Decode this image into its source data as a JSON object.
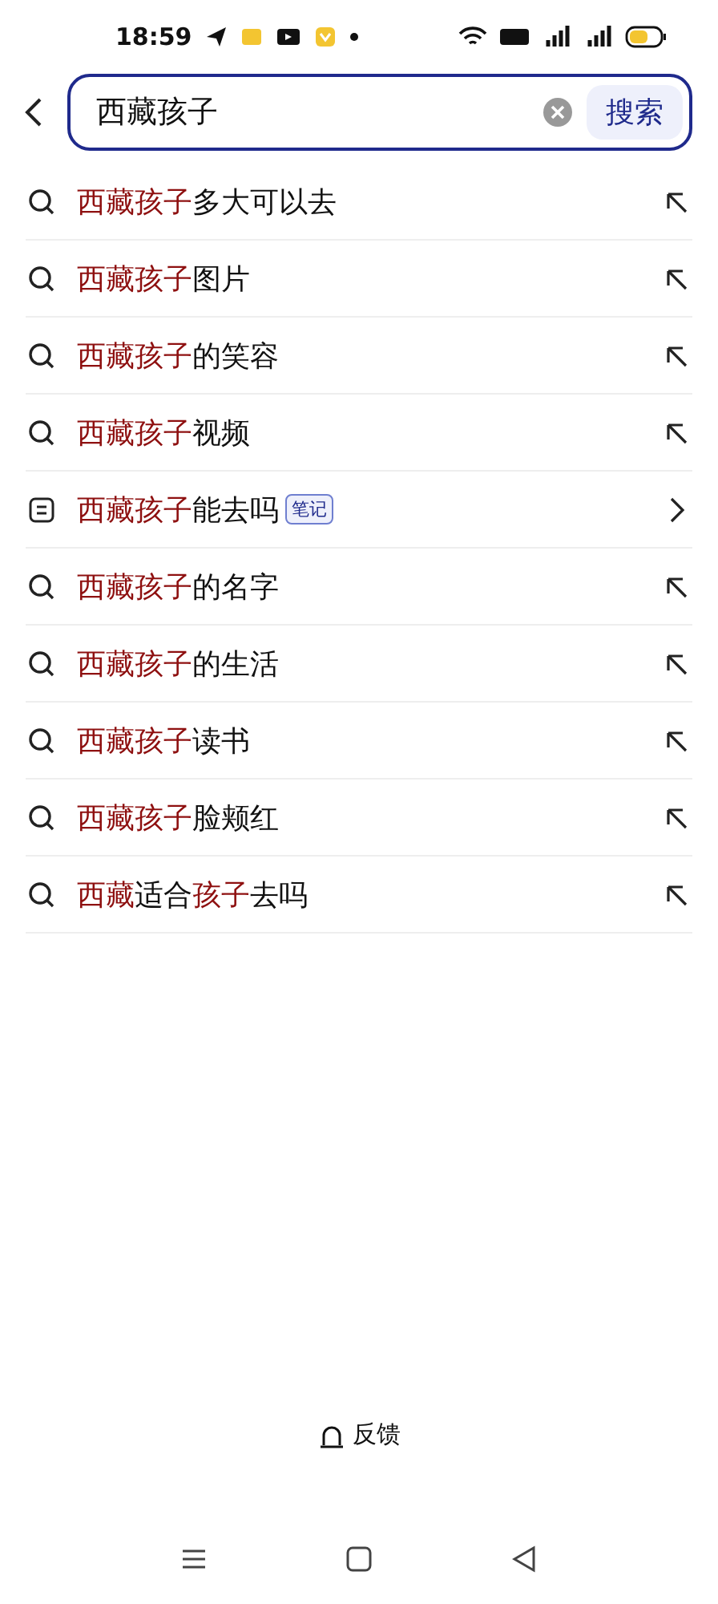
{
  "status_bar": {
    "time": "18:59"
  },
  "search": {
    "value": "西藏孩子",
    "button": "搜索"
  },
  "suggestions": [
    {
      "kind": "search",
      "parts": [
        {
          "text": "西藏孩子",
          "highlight": true
        },
        {
          "text": "多大可以去",
          "highlight": false
        }
      ]
    },
    {
      "kind": "search",
      "parts": [
        {
          "text": "西藏孩子",
          "highlight": true
        },
        {
          "text": "图片",
          "highlight": false
        }
      ]
    },
    {
      "kind": "search",
      "parts": [
        {
          "text": "西藏孩子",
          "highlight": true
        },
        {
          "text": "的笑容",
          "highlight": false
        }
      ]
    },
    {
      "kind": "search",
      "parts": [
        {
          "text": "西藏孩子",
          "highlight": true
        },
        {
          "text": "视频",
          "highlight": false
        }
      ]
    },
    {
      "kind": "note",
      "parts": [
        {
          "text": "西藏孩子",
          "highlight": true
        },
        {
          "text": "能去吗",
          "highlight": false
        }
      ],
      "badge": "笔记"
    },
    {
      "kind": "search",
      "parts": [
        {
          "text": "西藏孩子",
          "highlight": true
        },
        {
          "text": "的名字",
          "highlight": false
        }
      ]
    },
    {
      "kind": "search",
      "parts": [
        {
          "text": "西藏孩子",
          "highlight": true
        },
        {
          "text": "的生活",
          "highlight": false
        }
      ]
    },
    {
      "kind": "search",
      "parts": [
        {
          "text": "西藏孩子",
          "highlight": true
        },
        {
          "text": "读书",
          "highlight": false
        }
      ]
    },
    {
      "kind": "search",
      "parts": [
        {
          "text": "西藏孩子",
          "highlight": true
        },
        {
          "text": "脸颊红",
          "highlight": false
        }
      ]
    },
    {
      "kind": "search",
      "parts": [
        {
          "text": "西藏",
          "highlight": true
        },
        {
          "text": "适合",
          "highlight": false
        },
        {
          "text": "孩子",
          "highlight": true
        },
        {
          "text": "去吗",
          "highlight": false
        }
      ]
    }
  ],
  "feedback": "反馈"
}
